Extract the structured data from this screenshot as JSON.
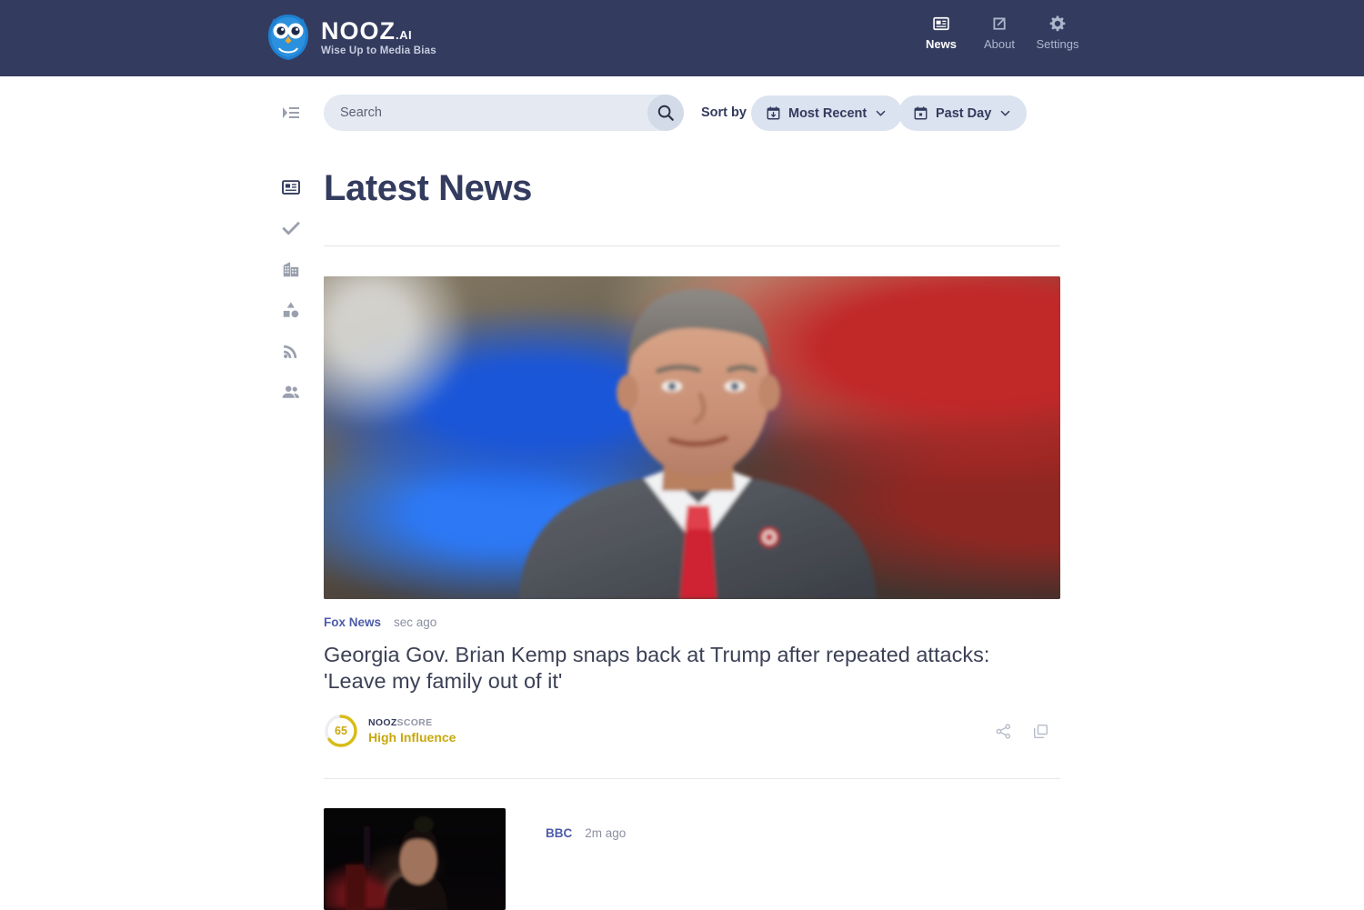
{
  "header": {
    "brand_name": "NOOZ",
    "brand_suffix": ".AI",
    "tagline": "Wise Up to Media Bias",
    "logo_icon": "owl-icon",
    "nav": [
      {
        "label": "News",
        "icon": "article-icon",
        "active": true
      },
      {
        "label": "About",
        "icon": "external-link-icon",
        "active": false
      },
      {
        "label": "Settings",
        "icon": "gear-icon",
        "active": false
      }
    ],
    "background_color": "#333b5e"
  },
  "toolbar": {
    "menu_toggle_icon": "menu-open-icon",
    "search": {
      "placeholder": "Search",
      "value": "",
      "button_icon": "search-icon"
    },
    "sort_label": "Sort by",
    "sort_dropdown": {
      "value": "Most Recent",
      "icon": "calendar-sort-icon",
      "chevron": "chevron-down-icon"
    },
    "range_dropdown": {
      "value": "Past Day",
      "icon": "calendar-icon",
      "chevron": "chevron-down-icon"
    }
  },
  "sidebar": {
    "items": [
      {
        "name": "news",
        "icon": "article-icon",
        "active": true
      },
      {
        "name": "fact-check",
        "icon": "check-icon",
        "active": false
      },
      {
        "name": "business",
        "icon": "building-icon",
        "active": false
      },
      {
        "name": "categories",
        "icon": "shapes-icon",
        "active": false
      },
      {
        "name": "feeds",
        "icon": "rss-icon",
        "active": false
      },
      {
        "name": "sources",
        "icon": "people-icon",
        "active": false
      }
    ]
  },
  "main": {
    "page_title": "Latest News",
    "articles": [
      {
        "source": "Fox News",
        "time": "sec ago",
        "headline": " Georgia Gov. Brian Kemp snaps back at Trump after repeated attacks: 'Leave my family out of it'",
        "image_alt": "man-in-gray-suit-red-tie",
        "nooz_score": {
          "value": "65",
          "kicker_bold": "NOOZ",
          "kicker_light": "SCORE",
          "label": "High Influence",
          "color": "#c9a80d"
        },
        "actions": [
          {
            "name": "share",
            "icon": "share-icon"
          },
          {
            "name": "compare",
            "icon": "copy-icon"
          }
        ]
      },
      {
        "source": "BBC",
        "time": "2m ago",
        "headline": "",
        "image_alt": "dark-portrait-thumbnail"
      }
    ]
  },
  "colors": {
    "navy": "#333b5e",
    "accent_gold": "#c9a80d",
    "source_link": "#4d5ca8",
    "pill_bg": "#dbe3f0",
    "search_bg": "#e4e9f2"
  }
}
